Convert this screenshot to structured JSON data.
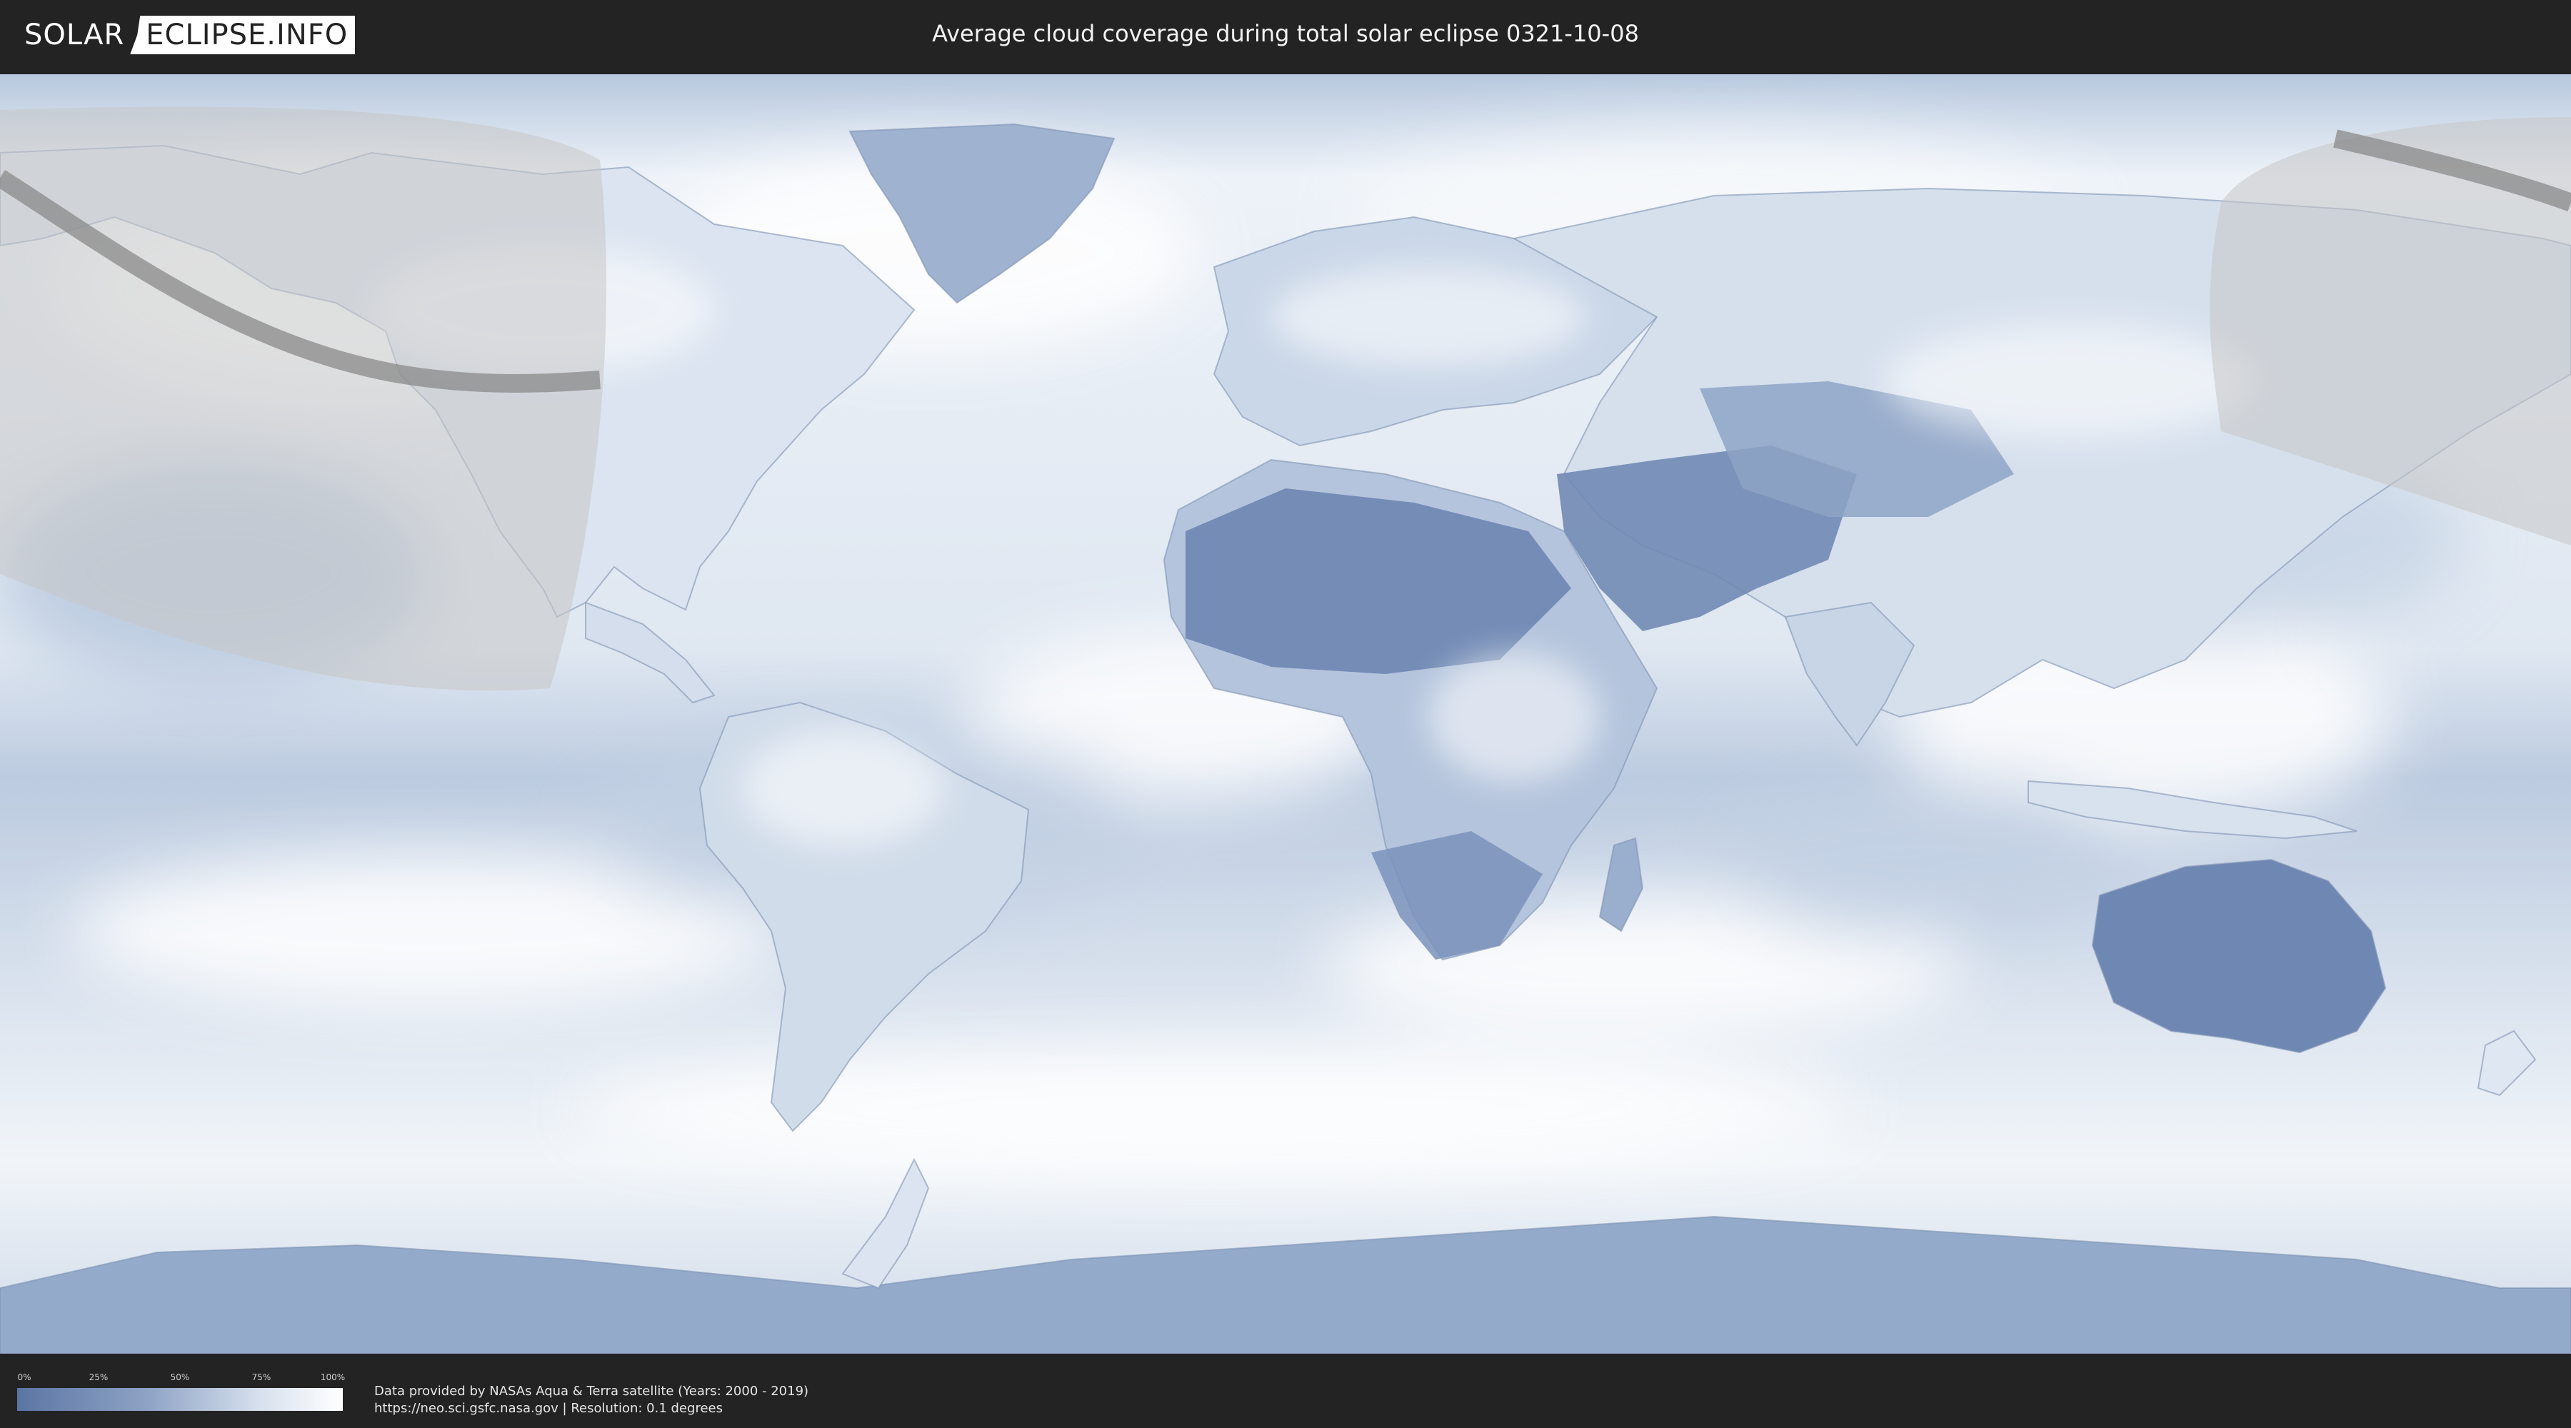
{
  "header": {
    "logo_left": "SOLAR",
    "logo_right": "ECLIPSE.INFO",
    "title": "Average cloud coverage during total solar eclipse 0321-10-08"
  },
  "legend": {
    "ticks": [
      "0%",
      "25%",
      "50%",
      "75%",
      "100%"
    ],
    "color_low": "#5b75a4",
    "color_high": "#ffffff"
  },
  "footer": {
    "credit_line1": "Data provided by NASAs Aqua & Terra satellite (Years: 2000 - 2019)",
    "credit_line2": "https://neo.sci.gsfc.nasa.gov | Resolution: 0.1 degrees"
  },
  "colors": {
    "clear_sky": "#6a84b2",
    "cloud": "#f4f7fb",
    "ocean_base": "#d9e3ee",
    "penumbra_overlay": "#c8c8c8",
    "totality_path": "#8a8a8a"
  }
}
